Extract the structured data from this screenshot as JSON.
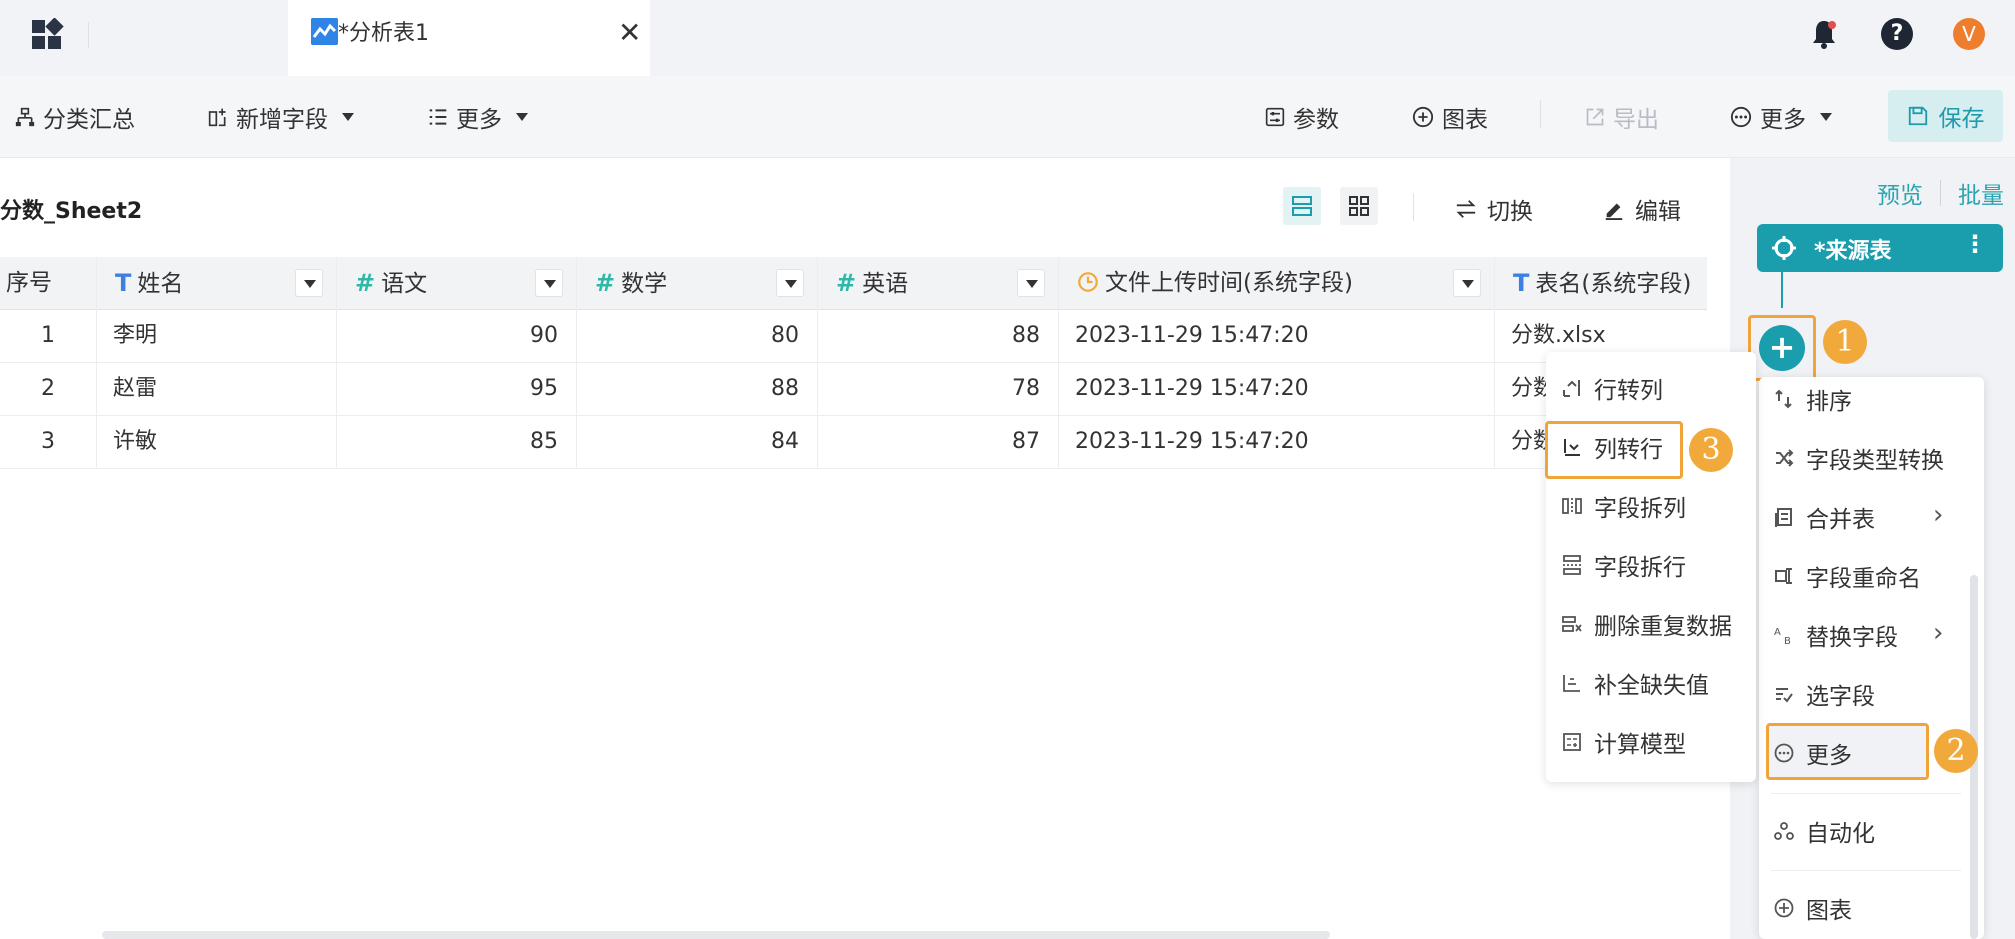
{
  "colors": {
    "accent": "#1a9ead",
    "highlight": "#f0a43a",
    "tab_icon": "#2f84e6",
    "avatar": "#ef7d2e"
  },
  "topbar": {
    "tab_title": "*分析表1",
    "tab_close": "✕",
    "help": "?",
    "avatar_letter": "V"
  },
  "toolbar": {
    "left": {
      "group_summary": "分类汇总",
      "add_field": "新增字段",
      "more": "更多"
    },
    "right": {
      "params": "参数",
      "chart": "图表",
      "export": "导出",
      "more": "更多",
      "save": "保存"
    }
  },
  "sheet": {
    "title": "分数_Sheet2",
    "switch_label": "切换",
    "edit_label": "编辑"
  },
  "table": {
    "headers": {
      "index": "序号",
      "name": "姓名",
      "chinese": "语文",
      "math": "数学",
      "english": "英语",
      "upload_time": "文件上传时间(系统字段)",
      "table_name": "表名(系统字段)"
    },
    "header_icons": {
      "text": "T",
      "number": "#"
    },
    "rows": [
      {
        "index": "1",
        "name": "李明",
        "chinese": "90",
        "math": "80",
        "english": "88",
        "upload_time": "2023-11-29 15:47:20",
        "table_name": "分数.xlsx"
      },
      {
        "index": "2",
        "name": "赵雷",
        "chinese": "95",
        "math": "88",
        "english": "78",
        "upload_time": "2023-11-29 15:47:20",
        "table_name": "分数"
      },
      {
        "index": "3",
        "name": "许敏",
        "chinese": "85",
        "math": "84",
        "english": "87",
        "upload_time": "2023-11-29 15:47:20",
        "table_name": "分数"
      }
    ]
  },
  "flow": {
    "preview": "预览",
    "batch": "批量",
    "source_node": "*来源表",
    "add": "+",
    "badges": [
      "1",
      "2",
      "3"
    ]
  },
  "op_menu": {
    "items": [
      "排序",
      "字段类型转换",
      "合并表",
      "字段重命名",
      "替换字段",
      "选字段",
      "更多",
      "自动化",
      "图表"
    ]
  },
  "more_submenu": {
    "items": [
      "行转列",
      "列转行",
      "字段拆列",
      "字段拆行",
      "删除重复数据",
      "补全缺失值",
      "计算模型"
    ]
  }
}
